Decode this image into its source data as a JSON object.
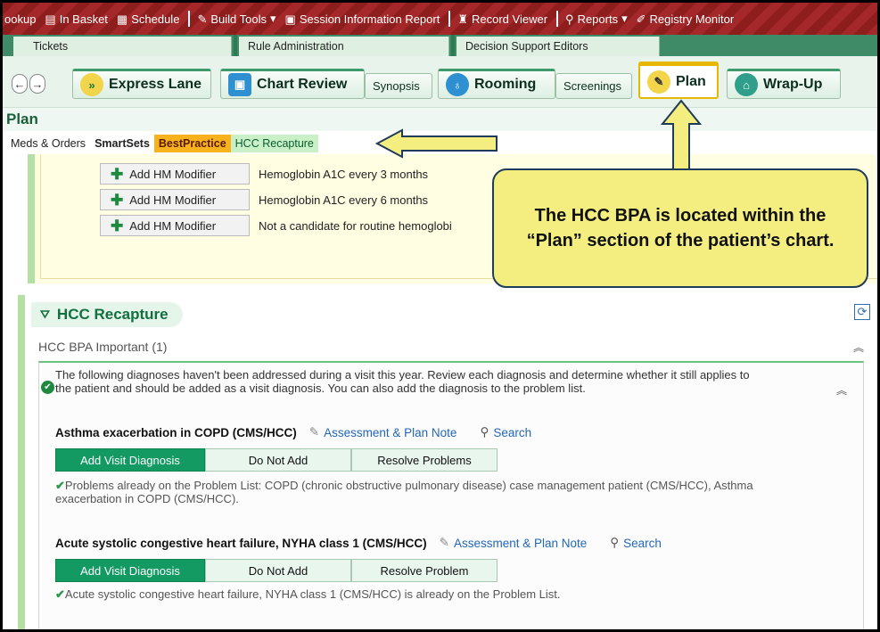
{
  "toolbar": {
    "items": [
      {
        "label": "ookup",
        "icon": ""
      },
      {
        "label": "In Basket",
        "icon": "inbasket-icon"
      },
      {
        "label": "Schedule",
        "icon": "calendar-icon"
      },
      {
        "label": "Build Tools",
        "icon": "wrench-icon"
      },
      {
        "label": "Session Information Report",
        "icon": "report-icon"
      },
      {
        "label": "Record Viewer",
        "icon": "binoculars-icon"
      },
      {
        "label": "Reports",
        "icon": "search-icon"
      },
      {
        "label": "Registry Monitor",
        "icon": "pencil-icon"
      }
    ]
  },
  "activity_tabs": [
    "Tickets",
    "Rule Administration",
    "Decision Support Editors"
  ],
  "nav": {
    "express_lane": "Express Lane",
    "chart_review": "Chart Review",
    "synopsis": "Synopsis",
    "rooming": "Rooming",
    "screenings": "Screenings",
    "plan": "Plan",
    "wrap_up": "Wrap-Up"
  },
  "plan_title": "Plan",
  "sublinks": {
    "meds_orders": "Meds & Orders",
    "smartsets": "SmartSets",
    "bestpractice": "BestPractice",
    "hcc_recapture": "HCC Recapture"
  },
  "hm": {
    "button_label": "Add HM Modifier",
    "rows": [
      "Hemoglobin A1C every 3 months",
      "Hemoglobin A1C every 6 months",
      "Not a candidate for routine hemoglobi"
    ]
  },
  "callout": "The HCC BPA is located within the “Plan” section of the patient’s chart.",
  "hcc": {
    "section_title": "HCC Recapture",
    "bpa_header": "HCC BPA Important (1)",
    "description": "The following diagnoses haven't been addressed during a visit this year. Review each diagnosis and determine whether it still applies to the patient and should be added as a visit diagnosis. You can also add the diagnosis to the problem list.",
    "diagnoses": [
      {
        "title": "Asthma exacerbation in COPD (CMS/HCC)",
        "note_link": "Assessment & Plan Note",
        "search_link": "Search",
        "buttons": [
          "Add Visit Diagnosis",
          "Do Not Add",
          "Resolve Problems"
        ],
        "status": "Problems already on the Problem List: COPD (chronic obstructive pulmonary disease) case management patient (CMS/HCC), Asthma exacerbation in COPD (CMS/HCC)."
      },
      {
        "title": "Acute systolic congestive heart failure, NYHA class 1 (CMS/HCC)",
        "note_link": "Assessment & Plan Note",
        "search_link": "Search",
        "buttons": [
          "Add Visit Diagnosis",
          "Do Not Add",
          "Resolve Problem"
        ],
        "status": "Acute systolic congestive heart failure, NYHA class 1 (CMS/HCC) is already on the Problem List."
      }
    ]
  },
  "colors": {
    "toolbar": "#a4282a",
    "accent_green": "#139a63",
    "bestpractice": "#f7b21e",
    "callout_fill": "#f3ee7f"
  }
}
